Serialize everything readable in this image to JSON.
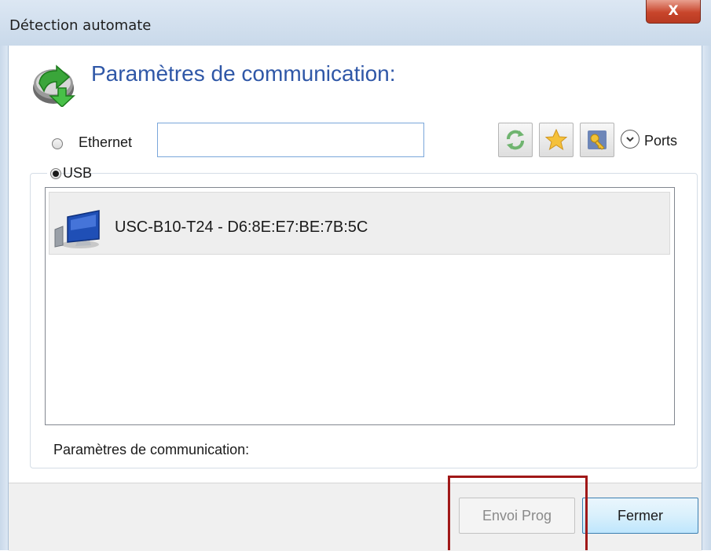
{
  "window": {
    "title": "Détection automate",
    "close_label": "X"
  },
  "header": {
    "title": "Paramètres de communication:",
    "icon": "green-arrow-refresh-icon"
  },
  "ethernet": {
    "label": "Ethernet",
    "selected": false,
    "address_value": ""
  },
  "toolbar": {
    "icons": [
      "refresh-icon",
      "favorite-star-icon",
      "key-icon"
    ],
    "ports_label": "Ports"
  },
  "usb": {
    "label": "USB",
    "selected": true,
    "devices": [
      {
        "name": "USC-B10-T24 - D6:8E:E7:BE:7B:5C",
        "icon": "computer-monitor-icon"
      }
    ]
  },
  "status": {
    "params_label": "Paramètres de communication:"
  },
  "buttons": {
    "send_label": "Envoi Prog",
    "close_label": "Fermer"
  },
  "colors": {
    "title_blue": "#2f57a7",
    "highlight_red": "#a01818"
  }
}
